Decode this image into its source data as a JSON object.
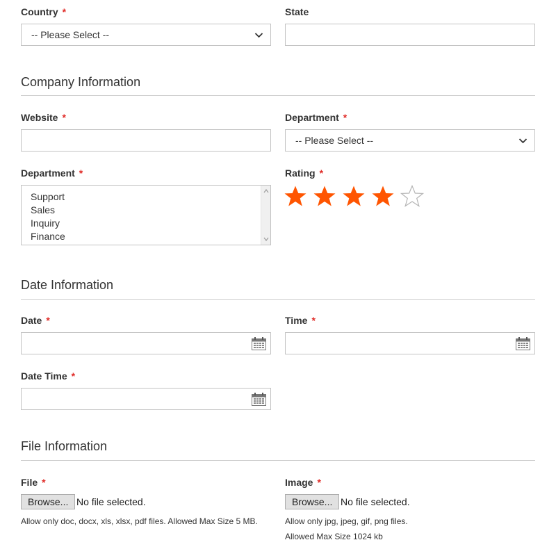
{
  "address": {
    "country_label": "Country",
    "country_value": "-- Please Select --",
    "state_label": "State",
    "required_mark": "*"
  },
  "company": {
    "section_title": "Company Information",
    "website_label": "Website",
    "department_select_label": "Department",
    "department_select_value": "-- Please Select --",
    "department_list_label": "Department",
    "department_options": [
      "Support",
      "Sales",
      "Inquiry",
      "Finance"
    ],
    "rating_label": "Rating",
    "rating": {
      "value": 4,
      "max": 5
    },
    "star_color": "#ff5501"
  },
  "dates": {
    "section_title": "Date Information",
    "date_label": "Date",
    "time_label": "Time",
    "datetime_label": "Date Time"
  },
  "files": {
    "section_title": "File Information",
    "file_label": "File",
    "image_label": "Image",
    "browse_label": "Browse...",
    "no_file_text": "No file selected.",
    "file_note": "Allow only doc, docx, xls, xlsx, pdf files. Allowed Max Size 5 MB.",
    "image_note_1": "Allow only jpg, jpeg, gif, png files.",
    "image_note_2": "Allowed Max Size 1024 kb"
  },
  "icons": {
    "chevron": "chevron-down-icon",
    "calendar": "calendar-icon",
    "star": "star-icon"
  }
}
